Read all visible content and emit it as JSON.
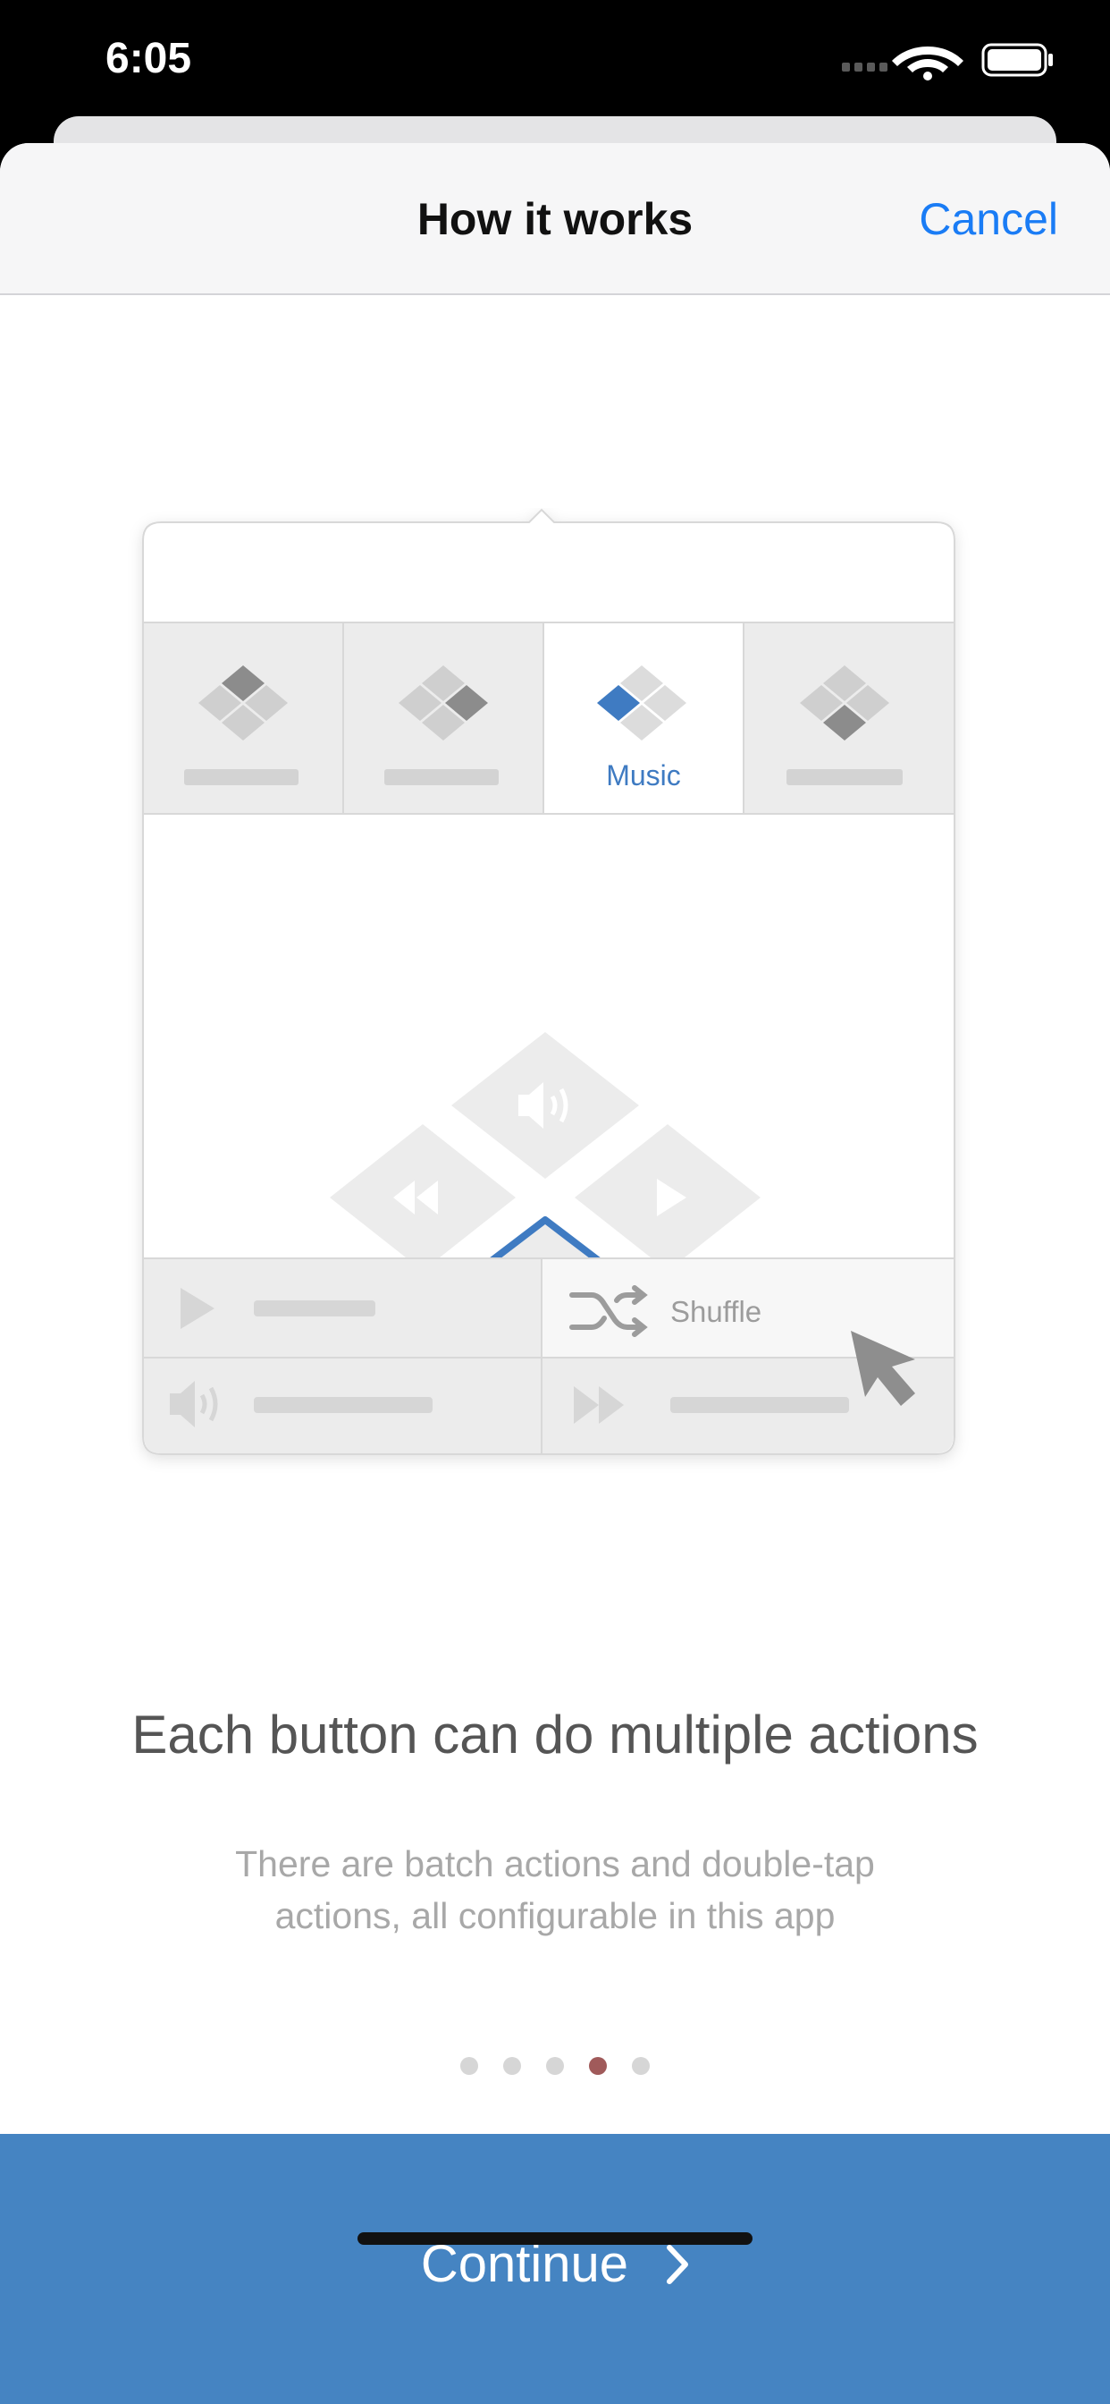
{
  "status_bar": {
    "time": "6:05"
  },
  "nav": {
    "title": "How it works",
    "cancel_label": "Cancel"
  },
  "illustration": {
    "tabs": [
      {
        "label": "",
        "active": false
      },
      {
        "label": "",
        "active": false
      },
      {
        "label": "Music",
        "active": true
      },
      {
        "label": "",
        "active": false
      }
    ],
    "highlighted_action": "Shuffle"
  },
  "onboarding": {
    "headline": "Each button can do multiple actions",
    "subtitle": "There are batch actions and double-tap actions, all configurable in this app",
    "page_count": 5,
    "current_page": 4
  },
  "footer": {
    "continue_label": "Continue"
  },
  "colors": {
    "accent": "#4584c2",
    "link": "#1a7cf5",
    "active_dot": "#a05a5a"
  }
}
